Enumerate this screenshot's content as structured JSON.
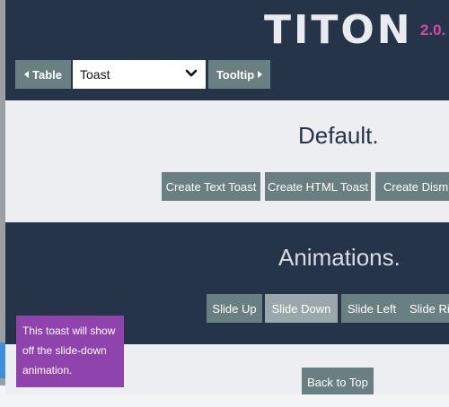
{
  "header": {
    "logo": "TITON",
    "version": "2.0.",
    "prev_label": "Table",
    "select_value": "Toast",
    "next_label": "Tooltip"
  },
  "default_section": {
    "title": "Default.",
    "buttons": [
      "Create Text Toast",
      "Create HTML Toast",
      "Create Dismis"
    ]
  },
  "animations_section": {
    "title": "Animations.",
    "buttons": [
      "Slide Up",
      "Slide Down",
      "Slide Left",
      "Slide Rig"
    ],
    "active_button": "Slide Down"
  },
  "back_to_top": "Back to Top",
  "toast": {
    "text": "This toast will show off the slide-down animation."
  },
  "colors": {
    "header_bg": "#253449",
    "button_bg": "#6a7f82",
    "toast_bg": "#8e43ad",
    "version_color": "#d24aa0"
  }
}
